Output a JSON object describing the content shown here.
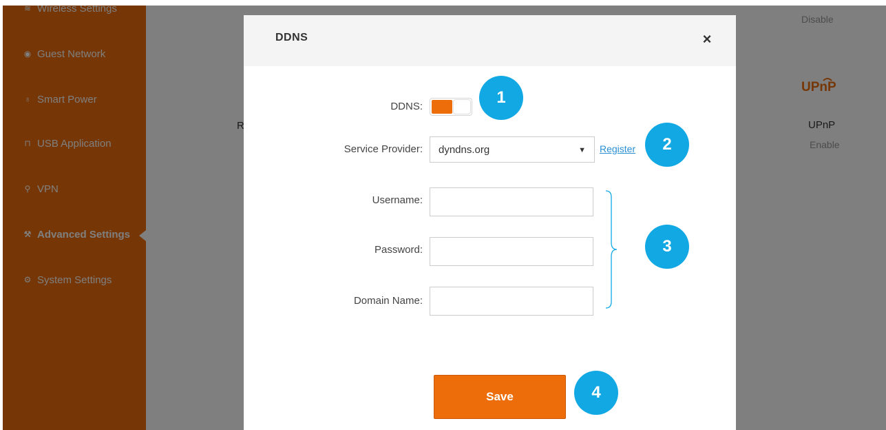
{
  "sidebar": {
    "items": [
      {
        "label": "Wireless Settings",
        "icon": "wifi-icon",
        "glyph": "≋"
      },
      {
        "label": "Guest Network",
        "icon": "guest-icon",
        "glyph": "◉"
      },
      {
        "label": "Smart Power",
        "icon": "bulb-icon",
        "glyph": "♁"
      },
      {
        "label": "USB Application",
        "icon": "usb-icon",
        "glyph": "⊓"
      },
      {
        "label": "VPN",
        "icon": "vpn-icon",
        "glyph": "⚲"
      },
      {
        "label": "Advanced Settings",
        "icon": "wrench-icon",
        "glyph": "⚒",
        "active": true
      },
      {
        "label": "System Settings",
        "icon": "gear-icon",
        "glyph": "⚙"
      }
    ]
  },
  "background": {
    "status_top_right": "Disable",
    "partial_letter": "R",
    "upnp_logo": "UPnP",
    "upnp_title": "UPnP",
    "upnp_state": "Enable"
  },
  "modal": {
    "title": "DDNS",
    "close_glyph": "×",
    "ddns_label": "DDNS:",
    "ddns_enabled": true,
    "service_provider_label": "Service Provider:",
    "service_provider_value": "dyndns.org",
    "register_link": "Register",
    "username_label": "Username:",
    "username_value": "",
    "password_label": "Password:",
    "password_value": "",
    "domain_label": "Domain Name:",
    "domain_value": "",
    "save_label": "Save"
  },
  "callouts": [
    "1",
    "2",
    "3",
    "4"
  ],
  "colors": {
    "accent": "#ed6d0a",
    "callout": "#11a8e4",
    "link": "#2a8fd4"
  }
}
